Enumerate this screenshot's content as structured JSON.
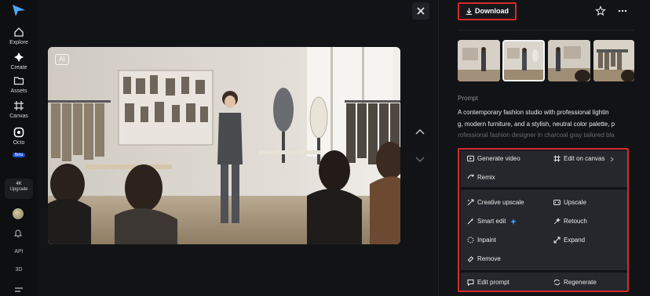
{
  "sidebar": {
    "items": [
      {
        "label": "Explore",
        "icon": "home-icon"
      },
      {
        "label": "Create",
        "icon": "sparkle-icon"
      },
      {
        "label": "Assets",
        "icon": "folder-icon"
      },
      {
        "label": "Canvas",
        "icon": "canvas-icon"
      },
      {
        "label": "Octo",
        "icon": "octo-icon",
        "badge": "Beta"
      }
    ],
    "upgrade": {
      "top": "4K",
      "label": "Upgrade"
    },
    "bottom": {
      "api": "API",
      "three_d": "3D"
    }
  },
  "canvas": {
    "ai_badge": "AI"
  },
  "toolbar": {
    "download_label": "Download"
  },
  "prompt": {
    "heading": "Prompt",
    "lines": [
      "A contemporary fashion studio with professional lightin",
      "g, modern furniture, and a stylish, neutral color palette, p",
      "rofessional fashion designer in charcoal gray tailored bla"
    ]
  },
  "menu": {
    "generate_video": "Generate video",
    "edit_on_canvas": "Edit on canvas",
    "remix": "Remix",
    "creative_upscale": "Creative upscale",
    "upscale": "Upscale",
    "smart_edit": "Smart edit",
    "retouch": "Retouch",
    "inpaint": "Inpaint",
    "expand": "Expand",
    "remove": "Remove",
    "edit_prompt": "Edit prompt",
    "regenerate": "Regenerate"
  },
  "colors": {
    "highlight_border": "#d42b2b",
    "accent": "#3aa0ff"
  }
}
